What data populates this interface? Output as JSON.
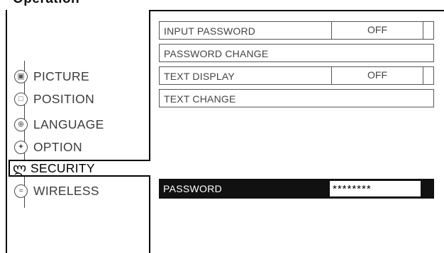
{
  "header_title": "Operation",
  "menu": {
    "items": [
      {
        "label": "PICTURE",
        "icon": "picture-icon"
      },
      {
        "label": "POSITION",
        "icon": "position-icon"
      },
      {
        "label": "LANGUAGE",
        "icon": "language-icon"
      },
      {
        "label": "OPTION",
        "icon": "option-icon"
      },
      {
        "label": "SECURITY",
        "icon": "key-icon"
      },
      {
        "label": "WIRELESS",
        "icon": "wireless-icon"
      }
    ],
    "selected": "SECURITY"
  },
  "panel": {
    "rows": [
      {
        "label": "INPUT PASSWORD",
        "value": "OFF"
      },
      {
        "label": "PASSWORD CHANGE",
        "value": ""
      },
      {
        "label": "TEXT DISPLAY",
        "value": "OFF"
      },
      {
        "label": "TEXT CHANGE",
        "value": ""
      }
    ]
  },
  "password_prompt": {
    "label": "PASSWORD",
    "value": "********"
  }
}
